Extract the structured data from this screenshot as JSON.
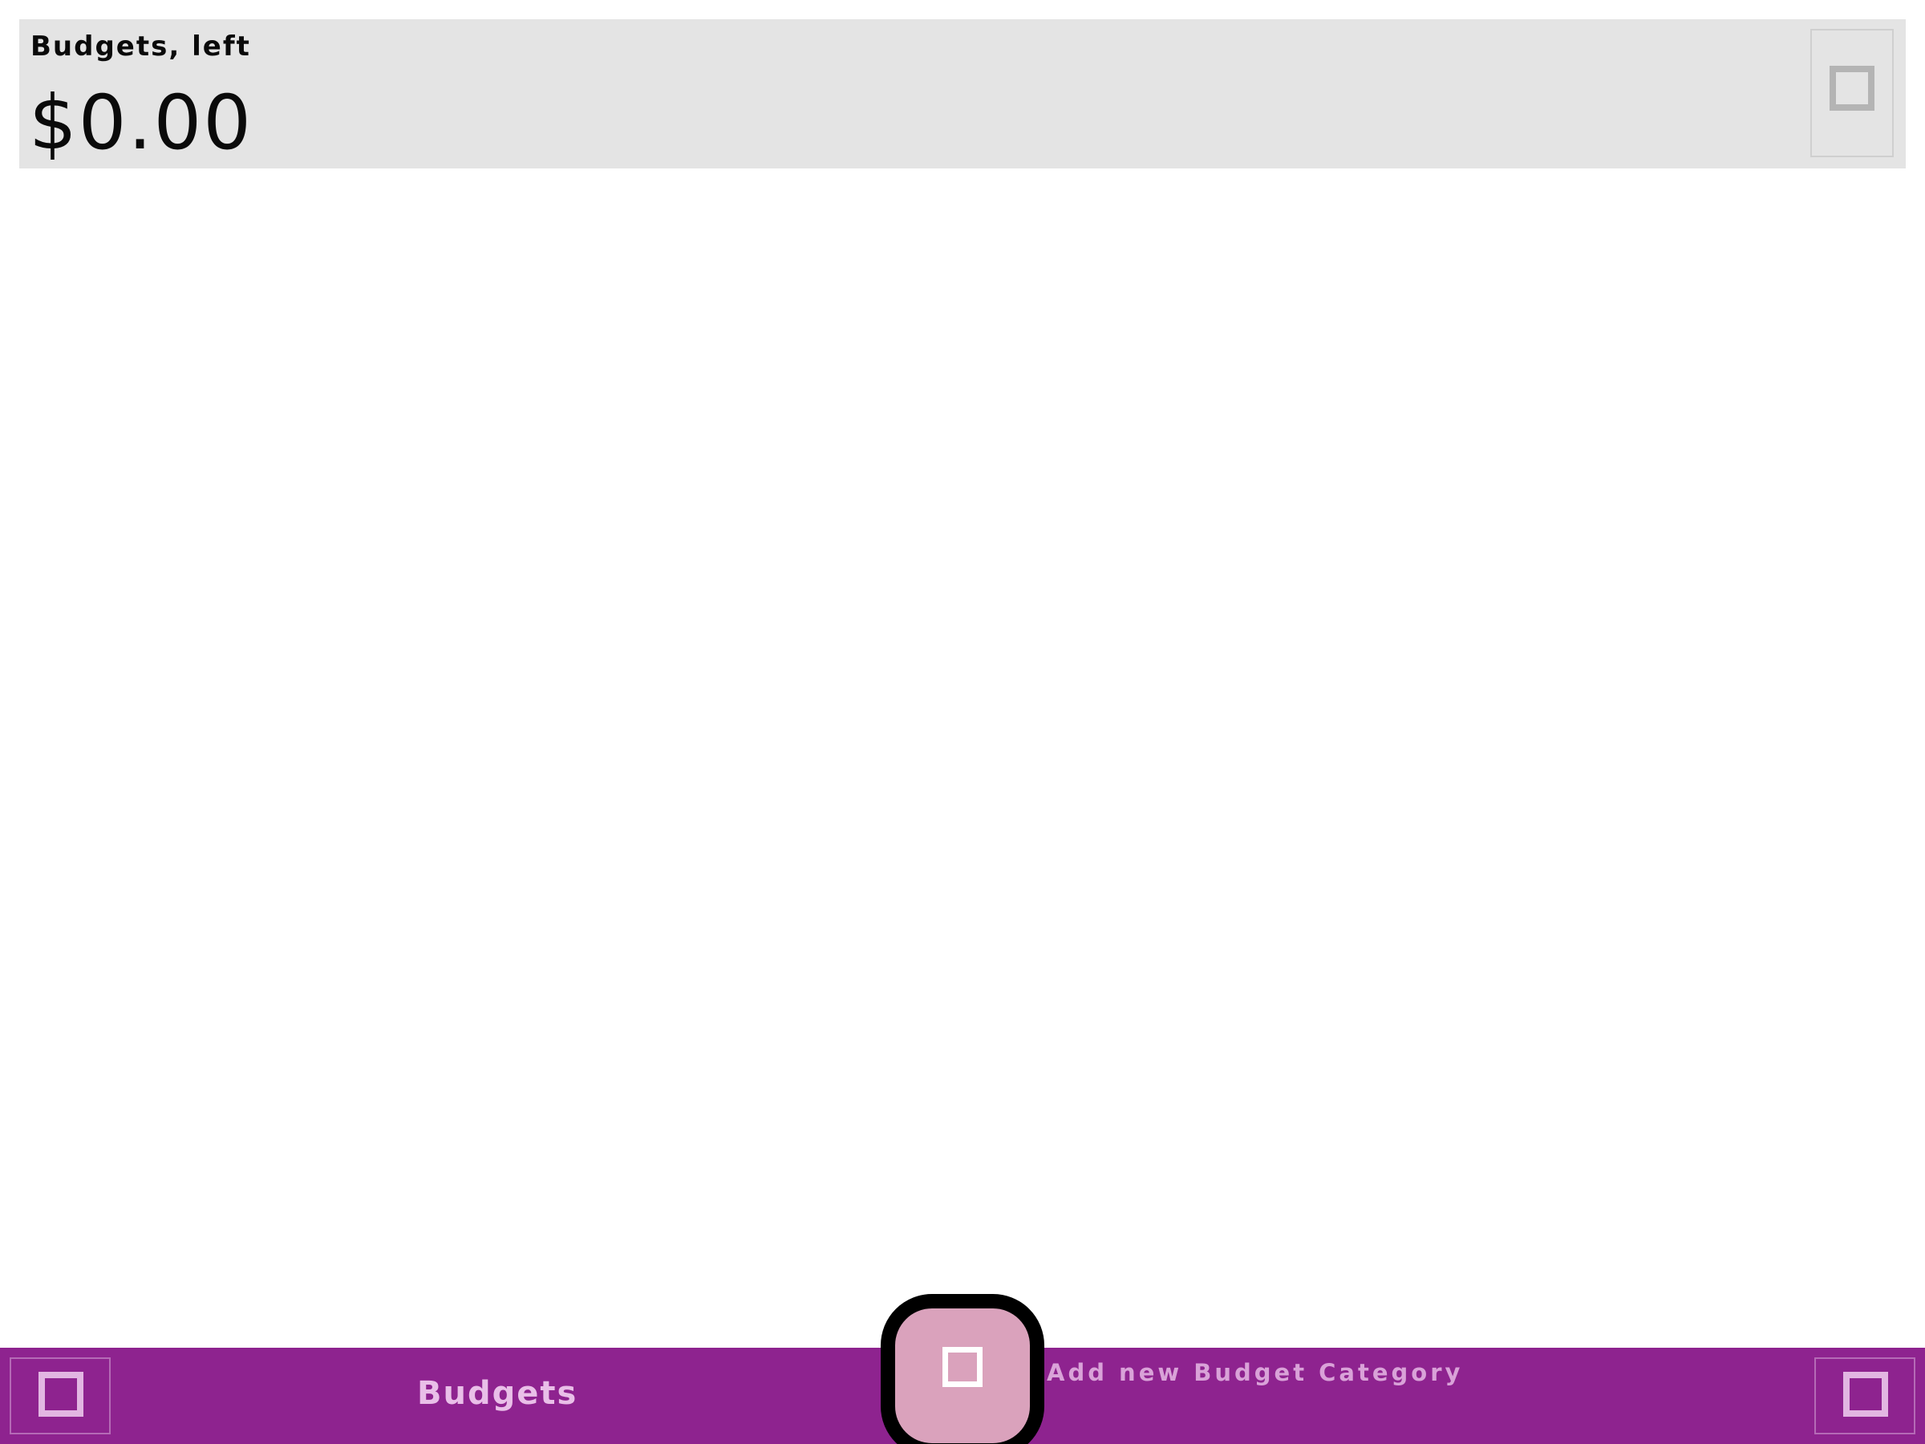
{
  "summary": {
    "label": "Budgets, left",
    "amount": "$0.00",
    "action_icon": "square-icon"
  },
  "bottom_bar": {
    "title": "Budgets",
    "add_hint": "Add new Budget Category",
    "left_icon": "square-icon",
    "right_icon": "square-icon",
    "fab_icon": "square-icon"
  },
  "colors": {
    "bar_background": "#8e238f",
    "fab_background": "#daa2bc",
    "card_background": "#e4e4e4",
    "bar_text": "#e9bfe8"
  }
}
